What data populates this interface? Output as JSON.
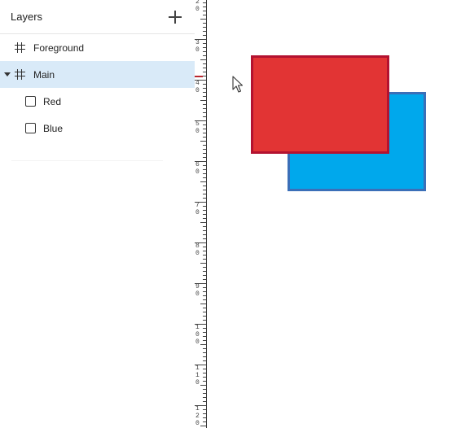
{
  "layers_panel": {
    "title": "Layers",
    "add_icon": "plus-icon",
    "items": [
      {
        "label": "Foreground",
        "type": "frame",
        "icon": "frame-icon",
        "selected": false
      },
      {
        "label": "Main",
        "type": "frame",
        "icon": "frame-icon",
        "expanded": true,
        "selected": true
      },
      {
        "label": "Red",
        "type": "rectangle",
        "icon": "rectangle-icon",
        "selected": false
      },
      {
        "label": "Blue",
        "type": "rectangle",
        "icon": "rectangle-icon",
        "selected": false
      }
    ]
  },
  "ruler": {
    "labels": [
      "2",
      "3",
      "4",
      "5",
      "6",
      "7",
      "8",
      "9",
      "10",
      "11",
      "12"
    ]
  },
  "canvas": {
    "shapes": [
      {
        "name": "Blue",
        "fill": "#00a8ec",
        "stroke": "#3b6fb8"
      },
      {
        "name": "Red",
        "fill": "#e23434",
        "stroke": "#b31230"
      }
    ],
    "cursor_icon": "arrow-cursor-icon"
  },
  "colors": {
    "selection": "#d9eaf8",
    "ruler_marker": "#b9272f"
  }
}
